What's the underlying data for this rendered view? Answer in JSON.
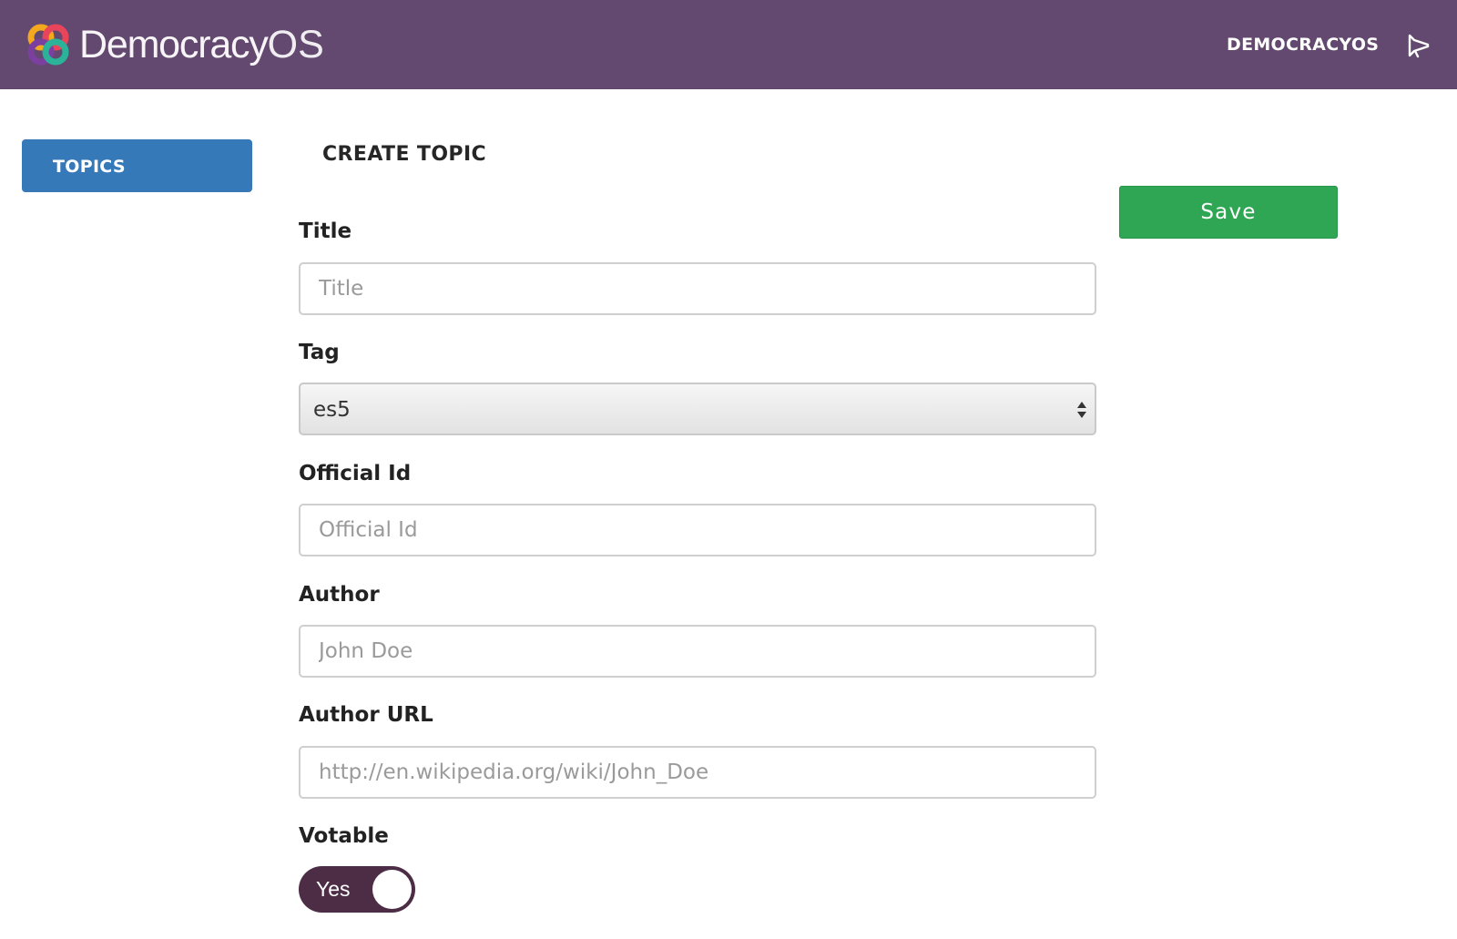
{
  "header": {
    "brand_main": "Democracy",
    "brand_suffix": "OS",
    "nav_link": "DEMOCRACYOS",
    "notifications_icon": "megaphone-icon",
    "background": "#63496f"
  },
  "sidebar": {
    "items": [
      {
        "label": "TOPICS",
        "active": true,
        "color": "#3579b9"
      }
    ]
  },
  "main": {
    "title": "CREATE TOPIC",
    "save_label": "Save",
    "save_color": "#2fa653",
    "fields": {
      "title": {
        "label": "Title",
        "placeholder": "Title",
        "value": ""
      },
      "tag": {
        "label": "Tag",
        "selected": "es5"
      },
      "official_id": {
        "label": "Official Id",
        "placeholder": "Official Id",
        "value": ""
      },
      "author": {
        "label": "Author",
        "placeholder": "John Doe",
        "value": ""
      },
      "author_url": {
        "label": "Author URL",
        "placeholder": "http://en.wikipedia.org/wiki/John_Doe",
        "value": ""
      },
      "votable": {
        "label": "Votable",
        "state_label": "Yes",
        "on": true,
        "color": "#4c2d45"
      }
    }
  }
}
